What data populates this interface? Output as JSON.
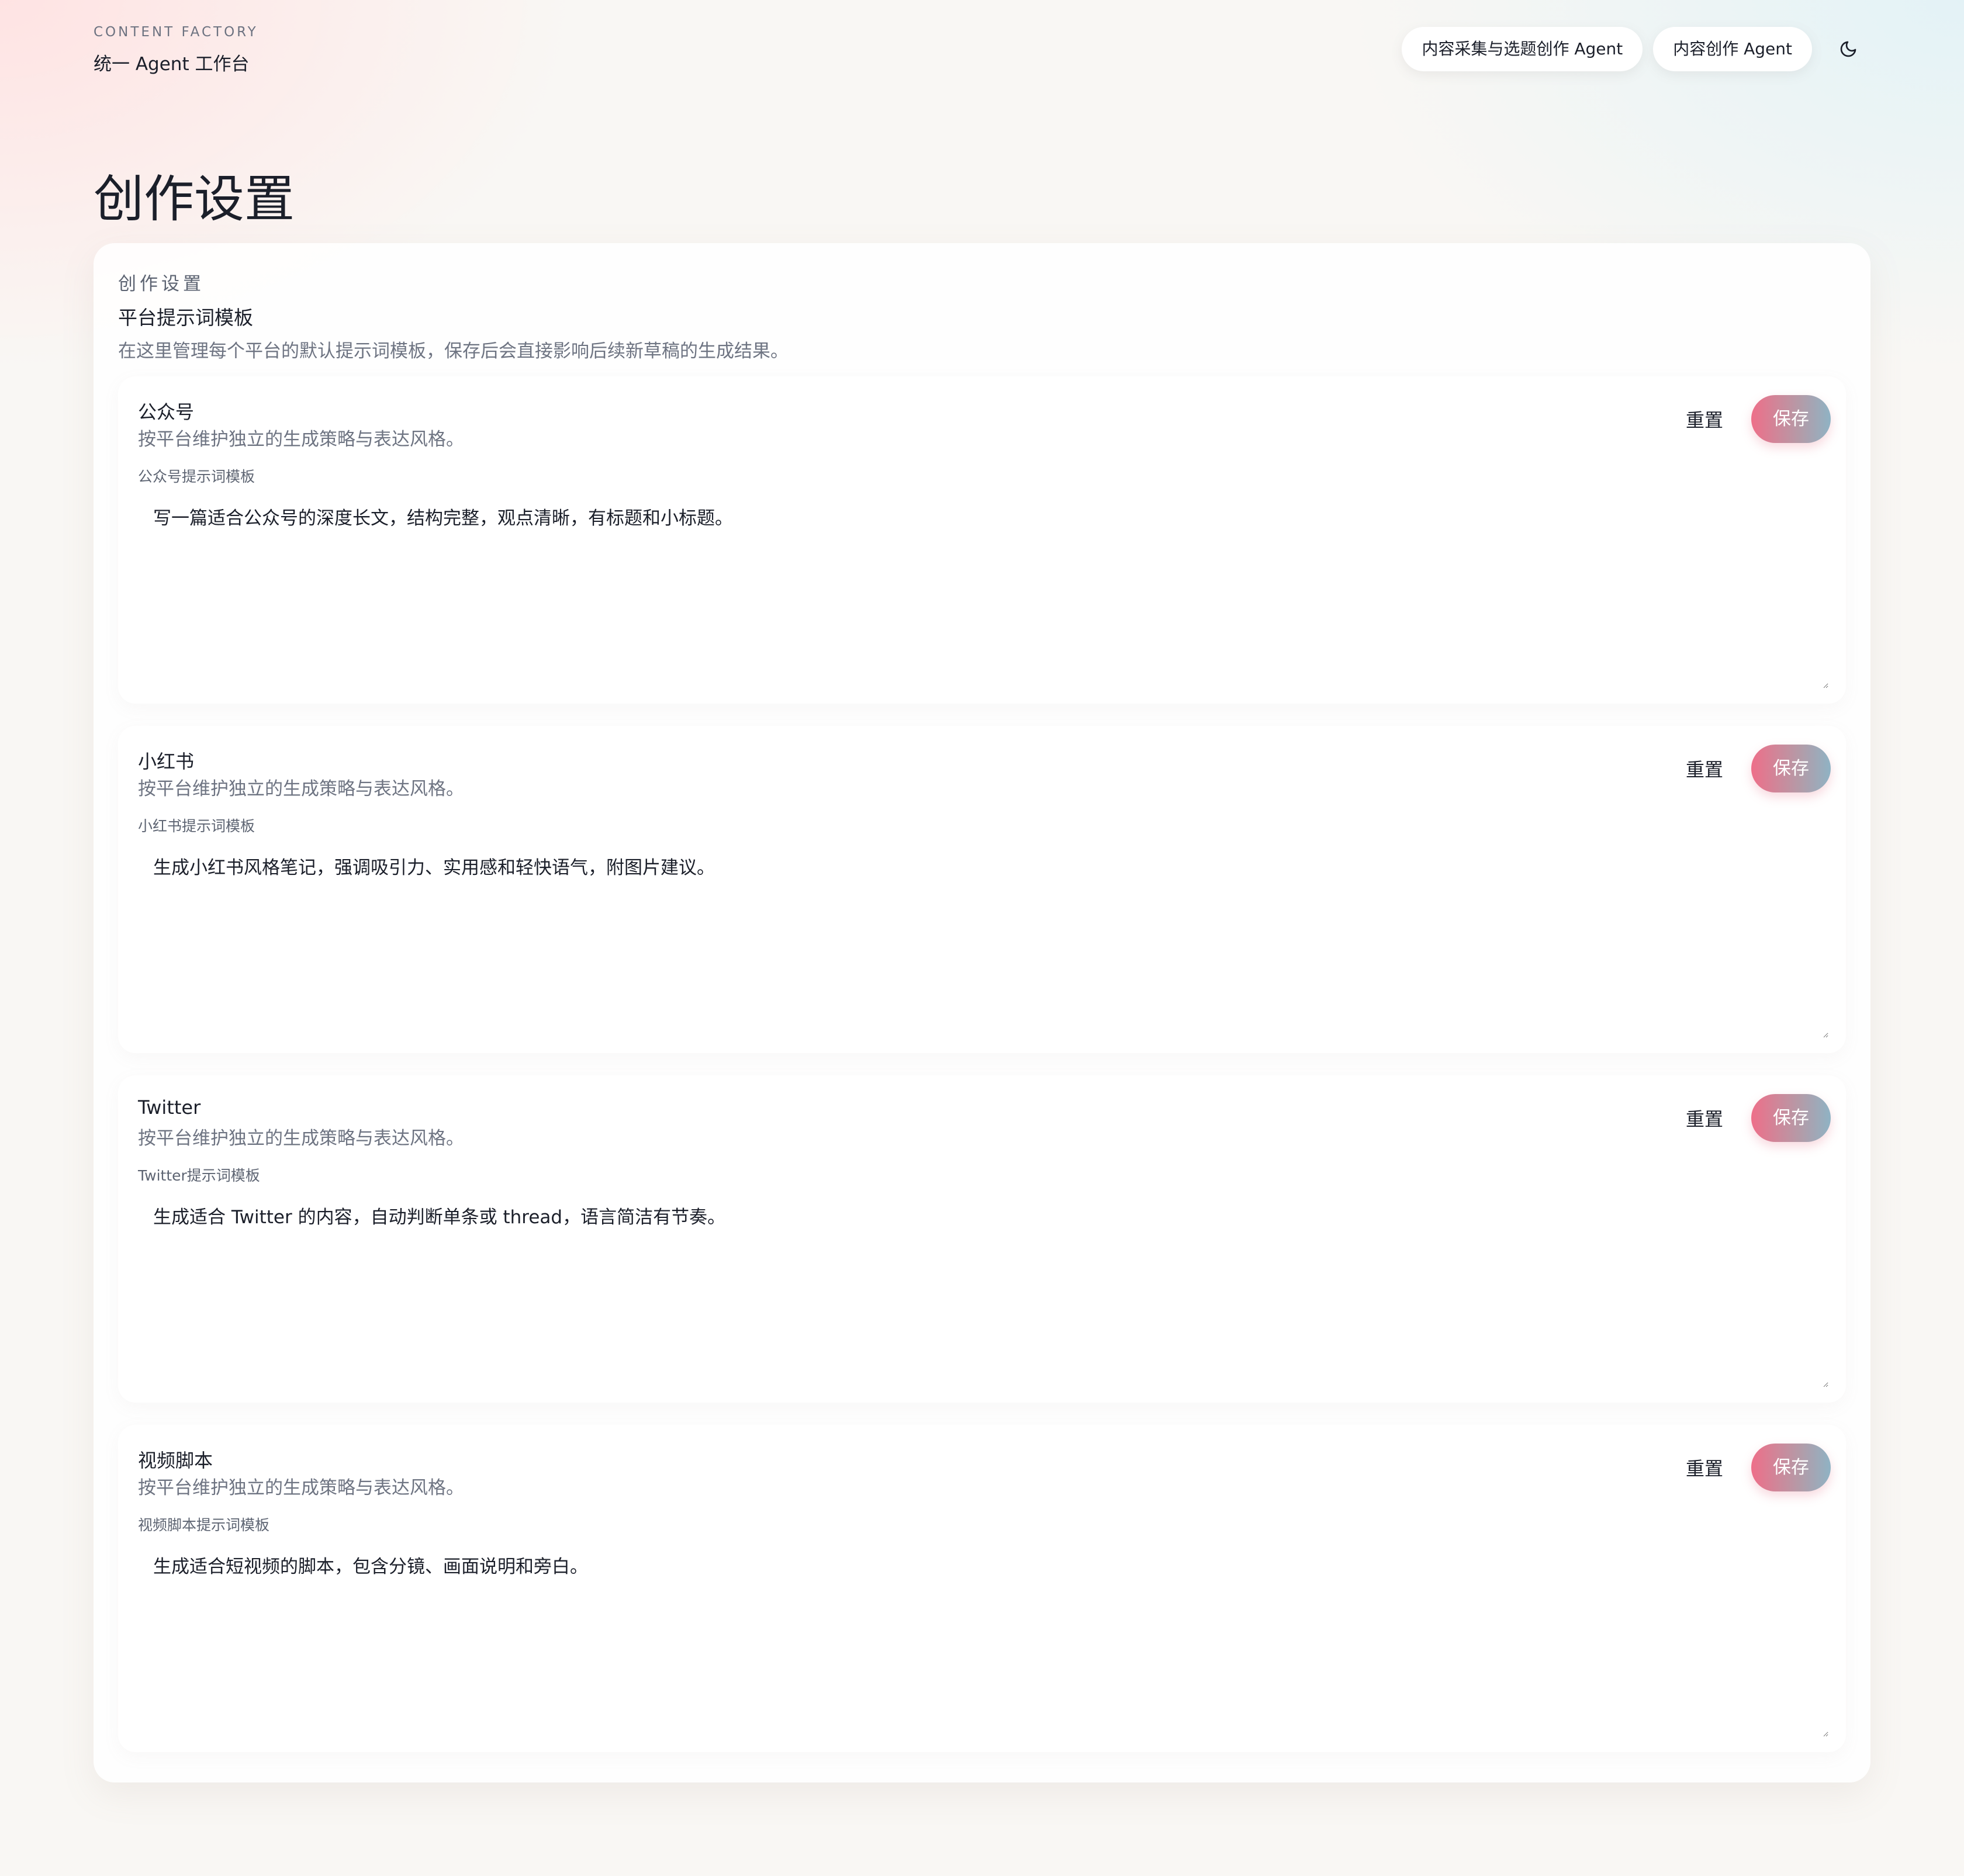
{
  "brand": {
    "eyebrow": "CONTENT FACTORY",
    "title": "统一 Agent 工作台"
  },
  "nav": {
    "agents": [
      "内容采集与选题创作 Agent",
      "内容创作 Agent"
    ],
    "theme_icon": "moon-icon"
  },
  "page": {
    "title": "创作设置"
  },
  "panel": {
    "eyebrow": "创作设置",
    "title": "平台提示词模板",
    "description": "在这里管理每个平台的默认提示词模板，保存后会直接影响后续新草稿的生成结果。"
  },
  "platforms": [
    {
      "name": "公众号",
      "description": "按平台维护独立的生成策略与表达风格。",
      "field_label": "公众号提示词模板",
      "template": "写一篇适合公众号的深度长文，结构完整，观点清晰，有标题和小标题。",
      "reset_label": "重置",
      "save_label": "保存"
    },
    {
      "name": "小红书",
      "description": "按平台维护独立的生成策略与表达风格。",
      "field_label": "小红书提示词模板",
      "template": "生成小红书风格笔记，强调吸引力、实用感和轻快语气，附图片建议。",
      "reset_label": "重置",
      "save_label": "保存"
    },
    {
      "name": "Twitter",
      "description": "按平台维护独立的生成策略与表达风格。",
      "field_label": "Twitter提示词模板",
      "template": "生成适合 Twitter 的内容，自动判断单条或 thread，语言简洁有节奏。",
      "reset_label": "重置",
      "save_label": "保存"
    },
    {
      "name": "视频脚本",
      "description": "按平台维护独立的生成策略与表达风格。",
      "field_label": "视频脚本提示词模板",
      "template": "生成适合短视频的脚本，包含分镜、画面说明和旁白。",
      "reset_label": "重置",
      "save_label": "保存"
    }
  ],
  "colors": {
    "accent_start": "#ee6f89",
    "accent_end": "#8fb3c4",
    "text": "#1b1f2a",
    "muted": "#6e7482"
  }
}
